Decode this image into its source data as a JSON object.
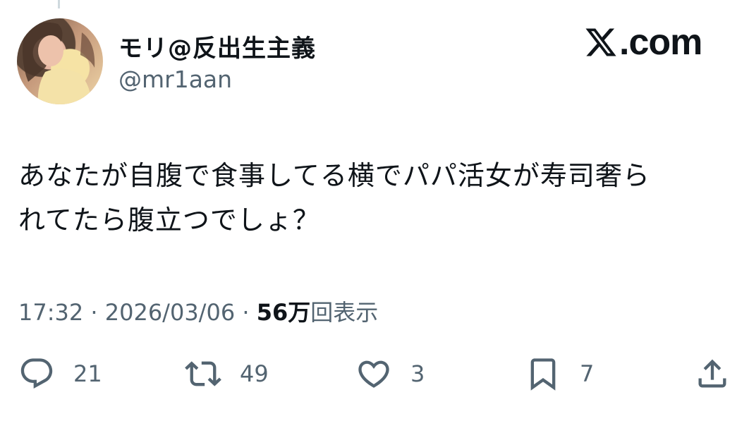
{
  "author": {
    "display_name": "モリ@反出生主義",
    "handle": "@mr1aan",
    "avatar_icon": "user-avatar-photo"
  },
  "brand": {
    "logo_icon": "x-logo-icon",
    "text": ".com"
  },
  "tweet": {
    "lines": [
      "あなたが自腹で食事してる横でパパ活女が寿司奢ら",
      "れてたら腹立つでしょ？"
    ]
  },
  "meta": {
    "time": "17:32",
    "separator": "·",
    "date": "2026/03/06",
    "views_count": "56万",
    "views_label": "回表示"
  },
  "actions": {
    "replies": "21",
    "reposts": "49",
    "likes": "3",
    "bookmarks": "7"
  },
  "colors": {
    "text": "#0f1419",
    "secondary": "#536471",
    "background": "#ffffff"
  }
}
